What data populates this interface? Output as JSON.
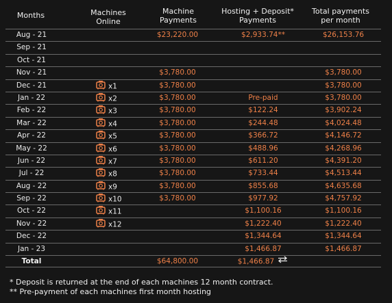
{
  "header": {
    "months": "Months",
    "machines_online": "Machines\nOnline",
    "machine_payments": "Machine\nPayments",
    "hosting_deposit": "Hosting + Deposit*\nPayments",
    "total_per_month": "Total payments\nper month"
  },
  "rows": [
    {
      "month": "Aug - 21",
      "machines": "",
      "machine_payment": "$23,220.00",
      "hosting": "$2,933.74**",
      "total": "$26,153.76"
    },
    {
      "month": "Sep - 21",
      "machines": "",
      "machine_payment": "",
      "hosting": "",
      "total": ""
    },
    {
      "month": "Oct - 21",
      "machines": "",
      "machine_payment": "",
      "hosting": "",
      "total": ""
    },
    {
      "month": "Nov - 21",
      "machines": "",
      "machine_payment": "$3,780.00",
      "hosting": "",
      "total": "$3,780.00"
    },
    {
      "month": "Dec - 21",
      "machines": "x1",
      "machine_payment": "$3,780.00",
      "hosting": "",
      "total": "$3,780.00"
    },
    {
      "month": "Jan - 22",
      "machines": "x2",
      "machine_payment": "$3,780.00",
      "hosting": "Pre-paid",
      "total": "$3,780.00"
    },
    {
      "month": "Feb - 22",
      "machines": "x3",
      "machine_payment": "$3,780.00",
      "hosting": "$122.24",
      "total": "$3,902.24"
    },
    {
      "month": "Mar - 22",
      "machines": "x4",
      "machine_payment": "$3,780.00",
      "hosting": "$244.48",
      "total": "$4,024.48"
    },
    {
      "month": "Apr - 22",
      "machines": "x5",
      "machine_payment": "$3,780.00",
      "hosting": "$366.72",
      "total": "$4,146.72"
    },
    {
      "month": "May - 22",
      "machines": "x6",
      "machine_payment": "$3,780.00",
      "hosting": "$488.96",
      "total": "$4,268.96"
    },
    {
      "month": "Jun - 22",
      "machines": "x7",
      "machine_payment": "$3,780.00",
      "hosting": "$611.20",
      "total": "$4,391.20"
    },
    {
      "month": "Jul - 22",
      "machines": "x8",
      "machine_payment": "$3,780.00",
      "hosting": "$733.44",
      "total": "$4,513.44"
    },
    {
      "month": "Aug - 22",
      "machines": "x9",
      "machine_payment": "$3,780.00",
      "hosting": "$855.68",
      "total": "$4,635.68"
    },
    {
      "month": "Sep - 22",
      "machines": "x10",
      "machine_payment": "$3,780.00",
      "hosting": "$977.92",
      "total": "$4,757.92"
    },
    {
      "month": "Oct - 22",
      "machines": "x11",
      "machine_payment": "",
      "hosting": "$1,100.16",
      "total": "$1,100.16"
    },
    {
      "month": "Nov - 22",
      "machines": "x12",
      "machine_payment": "",
      "hosting": "$1,222.40",
      "total": "$1,222.40"
    },
    {
      "month": "Dec - 22",
      "machines": "",
      "machine_payment": "",
      "hosting": "$1,344.64",
      "total": "$1,344.64"
    },
    {
      "month": "Jan - 23",
      "machines": "",
      "machine_payment": "",
      "hosting": "$1,466.87",
      "total": "$1,466.87"
    }
  ],
  "total": {
    "label": "Total",
    "machine_payment": "$64,800.00",
    "hosting": "$1,466.87"
  },
  "notes": {
    "deposit": "* Deposit is returned at the end of each machines 12 month contract.",
    "prepayment": "** Pre-payment of each machines first month hosting"
  },
  "icons": {
    "machine": "mining-machine-icon",
    "swap": "swap-arrows-icon"
  },
  "colors": {
    "accent": "#ee8048",
    "background": "#161616",
    "text": "#e9e9e9",
    "rule": "#6a6a6a"
  }
}
